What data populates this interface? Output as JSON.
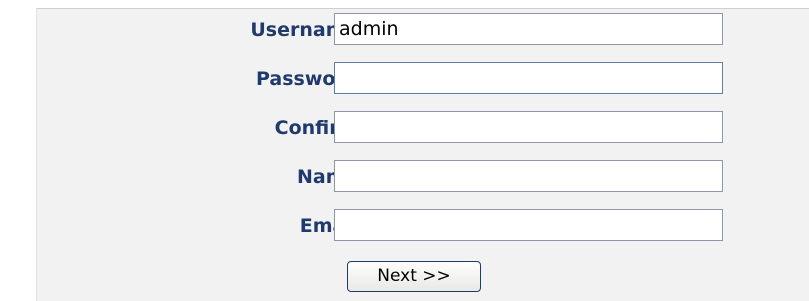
{
  "form": {
    "fields": [
      {
        "label": "Username:",
        "value": "admin",
        "placeholder": ""
      },
      {
        "label": "Password:",
        "value": "",
        "placeholder": ""
      },
      {
        "label": "Confirm:",
        "value": "",
        "placeholder": ""
      },
      {
        "label": "Name:",
        "value": "",
        "placeholder": ""
      },
      {
        "label": "Email:",
        "value": "",
        "placeholder": ""
      }
    ],
    "next_label": "Next >>"
  },
  "colors": {
    "label_text": "#1f3a6b",
    "panel_background": "#f2f2f2",
    "field_border": "#8c98a8"
  }
}
